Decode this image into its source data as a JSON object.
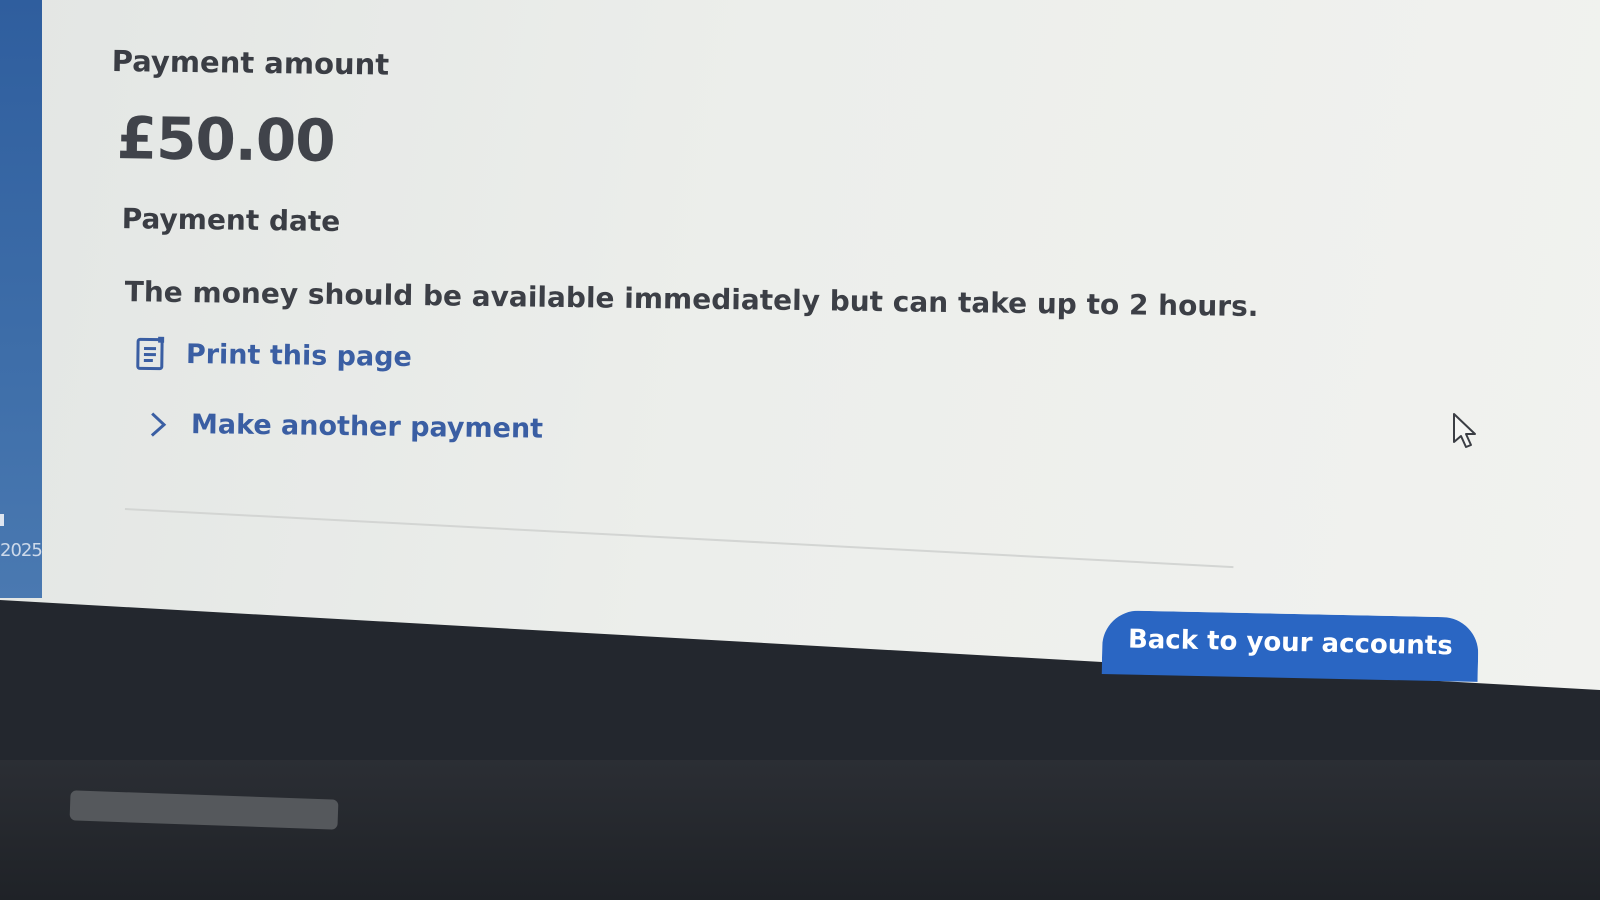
{
  "payment": {
    "amount_label": "Payment amount",
    "amount_value": "£50.00",
    "date_label": "Payment date",
    "availability_text": "The money should be available immediately but can take up to 2 hours."
  },
  "links": {
    "print_label": "Print this page",
    "another_payment_label": "Make another payment"
  },
  "actions": {
    "back_label": "Back to your accounts"
  },
  "sidebar": {
    "partial_text": "2025"
  },
  "colors": {
    "link": "#3a5ea3",
    "primary_button": "#2a66c3",
    "text": "#3a3d44",
    "sidebar": "#3e6ea9"
  },
  "icons": {
    "print": "print-icon",
    "chevron": "chevron-right-icon",
    "cursor": "mouse-pointer-icon"
  }
}
